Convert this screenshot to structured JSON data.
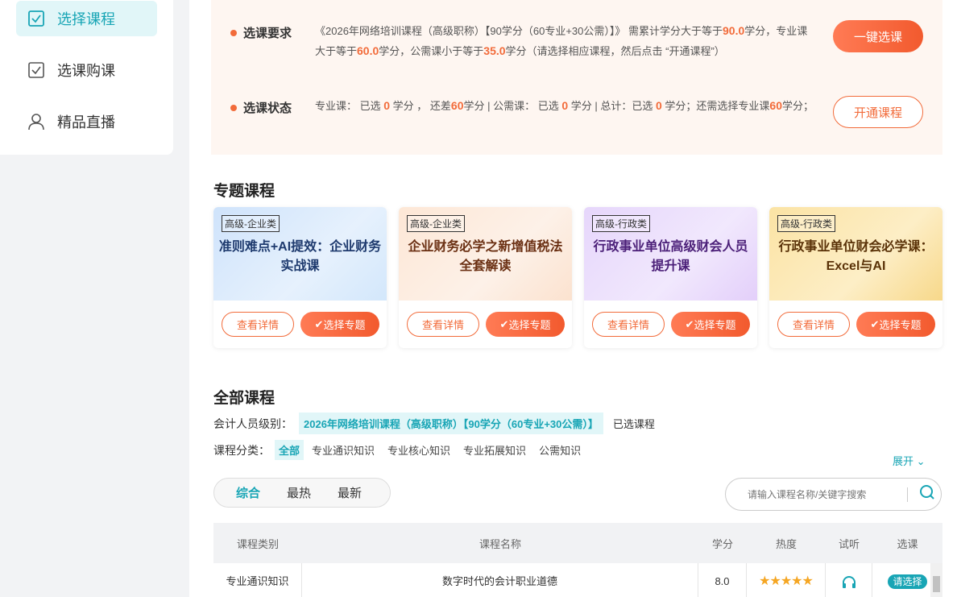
{
  "sidebar": {
    "items": [
      {
        "label": "选择课程",
        "icon": "checkbox-icon",
        "active": true
      },
      {
        "label": "选课购课",
        "icon": "checkbox-icon",
        "active": false
      },
      {
        "label": "精品直播",
        "icon": "user-icon",
        "active": false
      }
    ]
  },
  "requirements": {
    "req_label": "选课要求",
    "req_text_1": "《2026年网络培训课程（高级职称）【90学分（60专业+30公需）】》 需累计学分大于等于",
    "req_total": "90.0",
    "req_text_2": "学分，专业课大于等于",
    "req_pro": "60.0",
    "req_text_3": "学分，公需课小于等于",
    "req_pub": "35.0",
    "req_text_4": "学分（请选择相应课程，然后点击 “开通课程”）",
    "status_label": "选课状态",
    "st_1": "专业课： 已选",
    "st_pro_sel": "0",
    "st_2": "学分 ， 还差",
    "st_pro_left": "60",
    "st_3": "学分 | 公需课： 已选",
    "st_pub_sel": "0",
    "st_4": "学分 | 总计：已选",
    "st_total_sel": "0",
    "st_5": "学分；还需选择专业课",
    "st_need": "60",
    "st_6": "学分；",
    "one_click_label": "一键选课",
    "open_course_label": "开通课程"
  },
  "topics": {
    "title": "专题课程",
    "detail_label": "查看详情",
    "select_label": "选择专题",
    "cards": [
      {
        "tag": "高级-企业类",
        "title": "准则难点+AI提效：企业财务实战课",
        "color": "#1e3a6e"
      },
      {
        "tag": "高级-企业类",
        "title": "企业财务必学之新增值税法全套解读",
        "color": "#6a2f12"
      },
      {
        "tag": "高级-行政类",
        "title": "行政事业单位高级财会人员提升课",
        "color": "#4b1f78"
      },
      {
        "tag": "高级-行政类",
        "title": "行政事业单位财会必学课：Excel与AI",
        "color": "#5a3208"
      }
    ]
  },
  "all_courses": {
    "title": "全部课程",
    "level_label": "会计人员级别：",
    "level_value": "2026年网络培训课程（高级职称）【90学分（60专业+30公需）】",
    "selected_label": "已选课程",
    "category_label": "课程分类：",
    "categories": [
      "全部",
      "专业通识知识",
      "专业核心知识",
      "专业拓展知识",
      "公需知识"
    ],
    "expand_label": "展开",
    "sort_tabs": [
      "综合",
      "最热",
      "最新"
    ],
    "search_placeholder": "请输入课程名称/关键字搜索",
    "table": {
      "headers": [
        "课程类别",
        "课程名称",
        "学分",
        "热度",
        "试听",
        "选课"
      ],
      "rows": [
        {
          "category": "专业通识知识",
          "name": "数字时代的会计职业道德",
          "credit": "8.0",
          "stars": 5,
          "pick": "请选择"
        }
      ]
    }
  },
  "colors": {
    "accent": "#18a5b5",
    "orange": "#f26b3a"
  }
}
